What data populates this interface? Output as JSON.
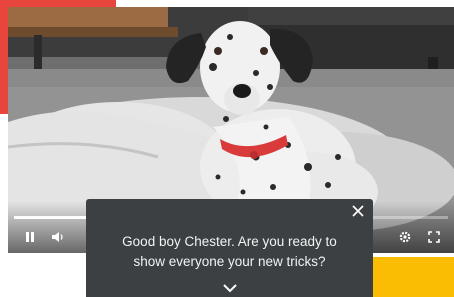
{
  "caption": {
    "text": "Good boy Chester. Are you ready to\nshow everyone your new tricks?"
  },
  "player": {
    "progress_fraction": 0.23,
    "controls": {
      "play_pause_icon": "pause-icon",
      "volume_icon": "volume-icon",
      "settings_icon": "gear-icon",
      "fullscreen_icon": "fullscreen-icon"
    }
  },
  "panel": {
    "close_icon": "close-icon",
    "expand_icon": "chevron-down-icon"
  },
  "colors": {
    "accent_red": "#e8453c",
    "accent_yellow": "#fbbc04",
    "panel_bg": "#3c4043",
    "dog_collar": "#d93b3b"
  }
}
